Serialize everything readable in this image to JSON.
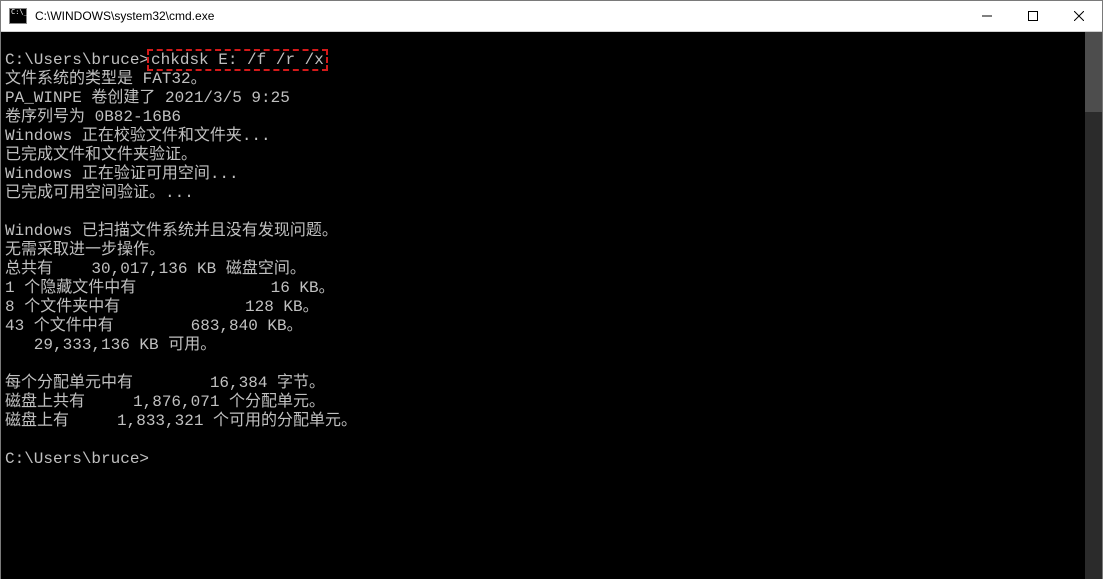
{
  "window": {
    "title": "C:\\WINDOWS\\system32\\cmd.exe"
  },
  "terminal": {
    "prompt": "C:\\Users\\bruce>",
    "highlight_cmd": "chkdsk E: /f /r /x",
    "lines": [
      "文件系统的类型是 FAT32。",
      "PA_WINPE 卷创建了 2021/3/5 9:25",
      "卷序列号为 0B82-16B6",
      "Windows 正在校验文件和文件夹...",
      "已完成文件和文件夹验证。",
      "Windows 正在验证可用空间...",
      "已完成可用空间验证。...",
      "",
      "Windows 已扫描文件系统并且没有发现问题。",
      "无需采取进一步操作。",
      "总共有    30,017,136 KB 磁盘空间。",
      "1 个隐藏文件中有              16 KB。",
      "8 个文件夹中有             128 KB。",
      "43 个文件中有        683,840 KB。",
      "   29,333,136 KB 可用。",
      "",
      "每个分配单元中有        16,384 字节。",
      "磁盘上共有     1,876,071 个分配单元。",
      "磁盘上有     1,833,321 个可用的分配单元。"
    ],
    "final_prompt": "C:\\Users\\bruce>"
  }
}
